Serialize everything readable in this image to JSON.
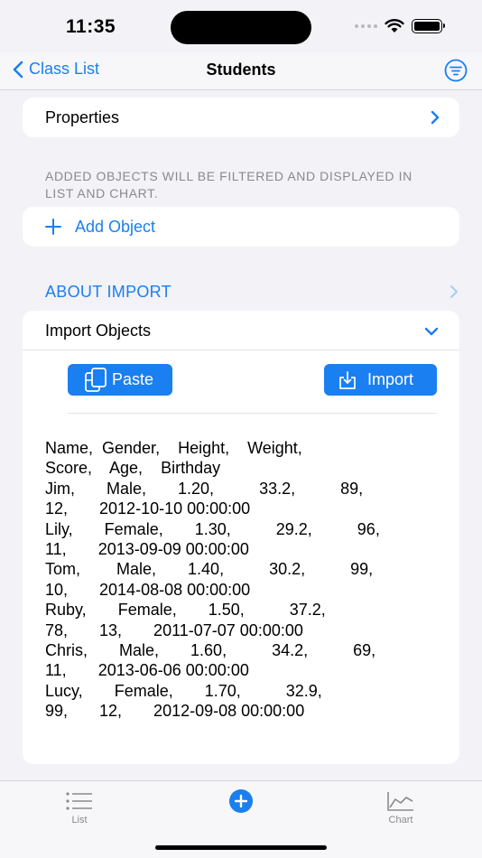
{
  "status_bar": {
    "time": "11:35"
  },
  "nav": {
    "back_label": "Class List",
    "title": "Students",
    "filter_icon": "filter-lines-icon",
    "back_icon": "chevron-left-icon"
  },
  "properties_row": {
    "label": "Properties"
  },
  "add_section": {
    "footer": "ADDED OBJECTS WILL BE FILTERED AND DISPLAYED IN LIST AND CHART.",
    "add_label": "Add Object"
  },
  "about_import": {
    "label": "ABOUT IMPORT"
  },
  "import_panel": {
    "title": "Import Objects",
    "paste_label": "Paste",
    "import_label": "Import",
    "text_lines": [
      "Name,  Gender,    Height,    Weight,",
      "Score,    Age,    Birthday",
      "Jim,       Male,       1.20,          33.2,          89,",
      "12,       2012-10-10 00:00:00",
      "Lily,       Female,       1.30,          29.2,          96,",
      "11,       2013-09-09 00:00:00",
      "Tom,        Male,       1.40,          30.2,          99,",
      "10,       2014-08-08 00:00:00",
      "Ruby,       Female,       1.50,          37.2,",
      "78,       13,       2011-07-07 00:00:00",
      "Chris,       Male,       1.60,          34.2,          69,",
      "11,       2013-06-06 00:00:00",
      "Lucy,       Female,       1.70,          32.9,",
      "99,       12,       2012-09-08 00:00:00"
    ]
  },
  "tab_bar": {
    "list_label": "List",
    "chart_label": "Chart"
  },
  "colors": {
    "accent": "#1a7ff0",
    "background": "#f2f2f7",
    "secondary_text": "#8a8a8e"
  }
}
